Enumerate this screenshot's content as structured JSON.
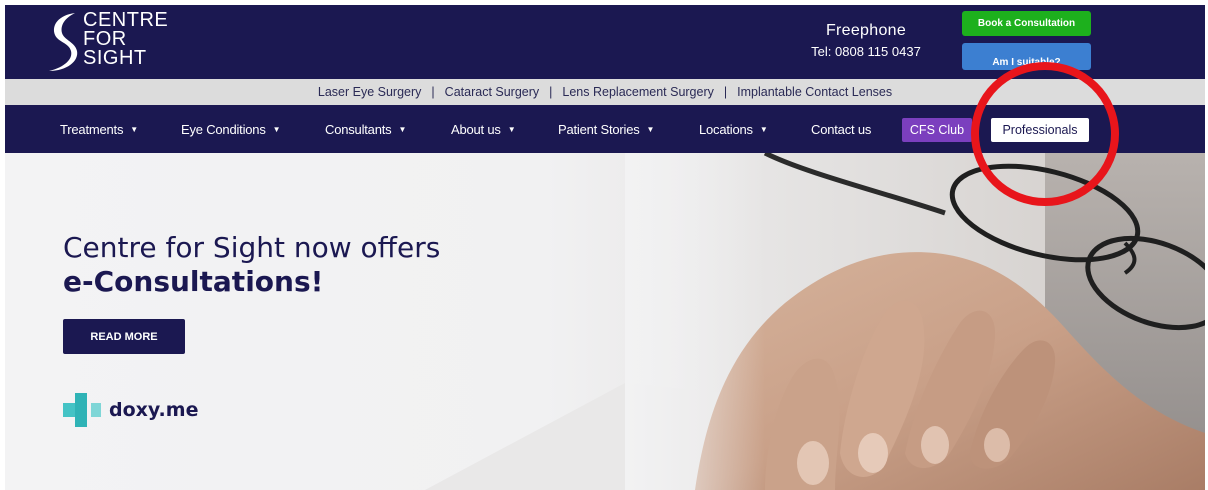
{
  "brand": {
    "logo_lines": [
      "CENTRE",
      "FOR",
      "SIGHT"
    ],
    "navy": "#1b1851",
    "green": "#1db01d",
    "blue": "#3c7fd1",
    "purple": "#7b3fbe",
    "annotation_red": "#e8151b"
  },
  "header": {
    "phone_label": "Freephone",
    "phone_number": "Tel: 0808 115 0437",
    "book_button": "Book a Consultation",
    "suitable_button": "Am I suitable?"
  },
  "toplinks": [
    "Laser Eye Surgery",
    "Cataract Surgery",
    "Lens Replacement Surgery",
    "Implantable Contact Lenses"
  ],
  "toplinks_separator": "|",
  "nav": {
    "items": [
      {
        "label": "Treatments",
        "caret": "▼"
      },
      {
        "label": "Eye Conditions",
        "caret": "▼"
      },
      {
        "label": "Consultants",
        "caret": "▼"
      },
      {
        "label": "About us",
        "caret": "▼"
      },
      {
        "label": "Patient Stories",
        "caret": "▼"
      },
      {
        "label": "Locations",
        "caret": "▼"
      },
      {
        "label": "Contact us",
        "caret": ""
      }
    ],
    "cfs_club": "CFS Club",
    "professionals": "Professionals"
  },
  "hero": {
    "title_line1": "Centre for Sight now offers",
    "title_line2": "e-Consultations!",
    "button": "READ MORE",
    "partner": "doxy.me"
  }
}
